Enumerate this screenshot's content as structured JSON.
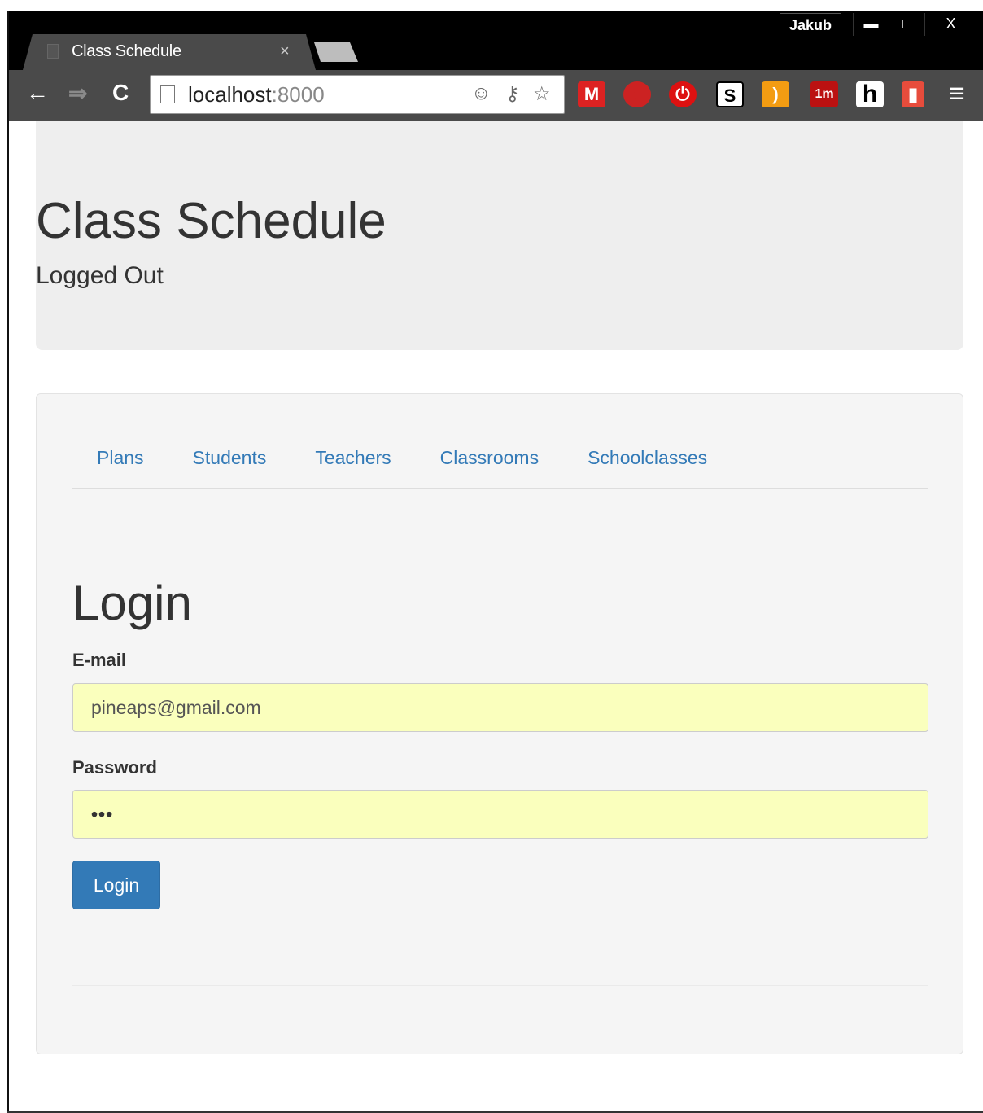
{
  "browser": {
    "tab_title": "Class Schedule",
    "tab_close": "×",
    "profile_name": "Jakub",
    "window_minimize": "▬",
    "window_maximize": "□",
    "window_close": "X",
    "nav_back": "←",
    "nav_forward": "⇒",
    "nav_reload": "C",
    "address_host": "localhost",
    "address_port": ":8000",
    "menu_glyph": "≡",
    "extensions": [
      {
        "name": "gmail-icon",
        "glyph": "M"
      },
      {
        "name": "tomato-icon",
        "glyph": "●"
      },
      {
        "name": "power-icon",
        "glyph": "⏻"
      },
      {
        "name": "s-extension-icon",
        "glyph": "S"
      },
      {
        "name": "rss-icon",
        "glyph": ")"
      },
      {
        "name": "timer-1m-icon",
        "glyph": "1m"
      },
      {
        "name": "h-extension-icon",
        "glyph": "h"
      },
      {
        "name": "book-icon",
        "glyph": "▮"
      }
    ]
  },
  "header": {
    "title": "Class Schedule",
    "status": "Logged Out"
  },
  "nav": {
    "items": [
      {
        "label": "Plans"
      },
      {
        "label": "Students"
      },
      {
        "label": "Teachers"
      },
      {
        "label": "Classrooms"
      },
      {
        "label": "Schoolclasses"
      }
    ]
  },
  "login": {
    "heading": "Login",
    "email_label": "E-mail",
    "email_value": "pineaps@gmail.com",
    "password_label": "Password",
    "password_value": "•••",
    "submit_label": "Login"
  },
  "colors": {
    "link": "#337ab7",
    "button": "#337ab7",
    "autofill": "#faffbd",
    "jumbotron": "#eeeeee",
    "well": "#f5f5f5"
  }
}
